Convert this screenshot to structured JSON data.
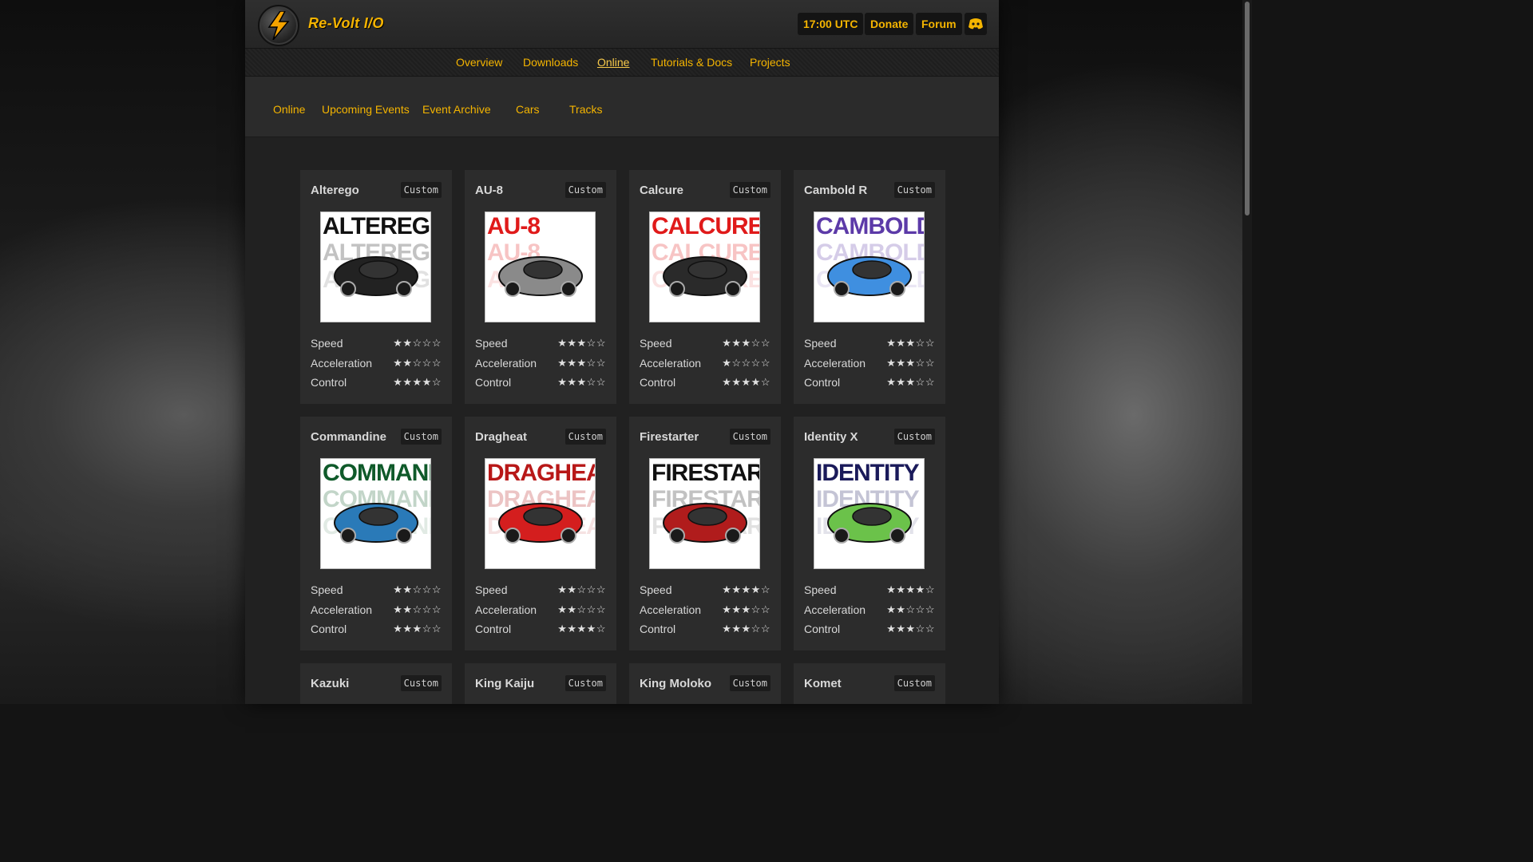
{
  "header": {
    "brand": "Re-Volt I/O",
    "time": "17:00 UTC",
    "donate": "Donate",
    "forum": "Forum"
  },
  "nav": [
    "Overview",
    "Downloads",
    "Online",
    "Tutorials & Docs",
    "Projects"
  ],
  "nav_active": "Online",
  "subnav": [
    "Online",
    "Upcoming Events",
    "Event Archive",
    "Cars",
    "Tracks"
  ],
  "stat_labels": {
    "speed": "Speed",
    "acceleration": "Acceleration",
    "control": "Control"
  },
  "colors": {
    "accent": "#f4b400",
    "card": "#2c2c2c",
    "page": "#212121"
  },
  "cars": [
    {
      "name": "Alterego",
      "tag": "Custom",
      "image_text": "ALTEREGO",
      "image_color": "#111111",
      "body_color": "#222222",
      "speed": 2,
      "acceleration": 2,
      "control": 4
    },
    {
      "name": "AU-8",
      "tag": "Custom",
      "image_text": "AU-8",
      "image_color": "#e01a1a",
      "body_color": "#8a8a8a",
      "speed": 3,
      "acceleration": 3,
      "control": 3
    },
    {
      "name": "Calcure",
      "tag": "Custom",
      "image_text": "CALCURE",
      "image_color": "#e01a1a",
      "body_color": "#2a2a2a",
      "speed": 3,
      "acceleration": 1,
      "control": 4
    },
    {
      "name": "Cambold R",
      "tag": "Custom",
      "image_text": "CAMBOLD",
      "image_color": "#5c3aa8",
      "body_color": "#3f8fe0",
      "speed": 3,
      "acceleration": 3,
      "control": 3
    },
    {
      "name": "Commandine",
      "tag": "Custom",
      "image_text": "COMMANDINE",
      "image_color": "#0f5a2a",
      "body_color": "#2a7ab8",
      "speed": 2,
      "acceleration": 2,
      "control": 3
    },
    {
      "name": "Dragheat",
      "tag": "Custom",
      "image_text": "DRAGHEAT",
      "image_color": "#b81818",
      "body_color": "#d41e1e",
      "speed": 2,
      "acceleration": 2,
      "control": 4
    },
    {
      "name": "Firestarter",
      "tag": "Custom",
      "image_text": "FIRESTARTER",
      "image_color": "#111111",
      "body_color": "#b01c1c",
      "speed": 4,
      "acceleration": 3,
      "control": 3
    },
    {
      "name": "Identity X",
      "tag": "Custom",
      "image_text": "IDENTITY X",
      "image_color": "#1a1a5a",
      "body_color": "#6bc24a",
      "speed": 4,
      "acceleration": 2,
      "control": 3
    },
    {
      "name": "Kazuki",
      "tag": "Custom"
    },
    {
      "name": "King Kaiju",
      "tag": "Custom"
    },
    {
      "name": "King Moloko",
      "tag": "Custom"
    },
    {
      "name": "Komet",
      "tag": "Custom"
    }
  ]
}
